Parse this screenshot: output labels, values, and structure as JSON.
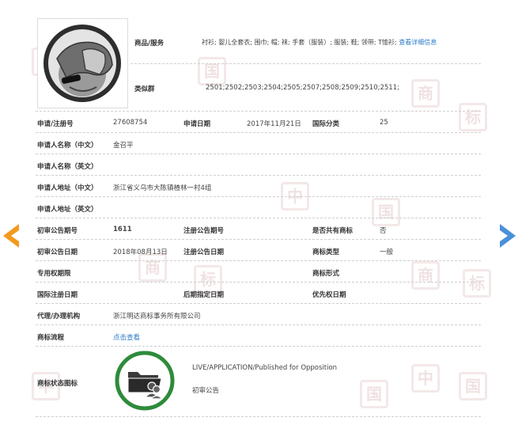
{
  "goods": {
    "label": "商品/服务",
    "value": "衬衫; 婴儿全套衣; 围巾; 帽; 袜; 手套（服装）; 服装; 鞋; 领带; T恤衫;",
    "link": "查看详细信息"
  },
  "similar_group": {
    "label": "类似群",
    "value": "2501;2502;2503;2504;2505;2507;2508;2509;2510;2511;"
  },
  "rows": {
    "reg_no_label": "申请/注册号",
    "reg_no": "27608754",
    "apply_date_label": "申请日期",
    "apply_date": "2017年11月21日",
    "intl_class_label": "国际分类",
    "intl_class": "25",
    "applicant_cn_label": "申请人名称（中文）",
    "applicant_cn": "金召平",
    "applicant_en_label": "申请人名称（英文）",
    "address_cn_label": "申请人地址（中文）",
    "address_cn": "浙江省义乌市大陈镇楂林一村4组",
    "address_en_label": "申请人地址（英文）",
    "prelim_issue_label": "初审公告期号",
    "prelim_issue": "1611",
    "reg_issue_label": "注册公告期号",
    "shared_label": "是否共有商标",
    "shared": "否",
    "prelim_date_label": "初审公告日期",
    "prelim_date": "2018年08月13日",
    "reg_date_label": "注册公告日期",
    "mark_type_label": "商标类型",
    "mark_type": "一般",
    "exclusive_label": "专用权期限",
    "mark_form_label": "商标形式",
    "intl_reg_date_label": "国际注册日期",
    "later_date_label": "后期指定日期",
    "priority_date_label": "优先权日期",
    "agent_label": "代理/办理机构",
    "agent": "浙江明达商标事务所有限公司",
    "process_label": "商标流程",
    "process_link": "点击查看",
    "status_label": "商标状态图标",
    "status_en": "LIVE/APPLICATION/Published for Opposition",
    "status_cn": "初审公告"
  },
  "icons": {
    "mark_image": "covering-face-photo",
    "status_icon": "folder-users-icon",
    "nav_prev": "arrow-left-icon",
    "nav_next": "arrow-right-icon"
  },
  "colors": {
    "status_ring": "#2e8b3a",
    "nav_prev": "#f29a1e",
    "nav_next": "#4a90d9",
    "link": "#2a7bc9"
  }
}
